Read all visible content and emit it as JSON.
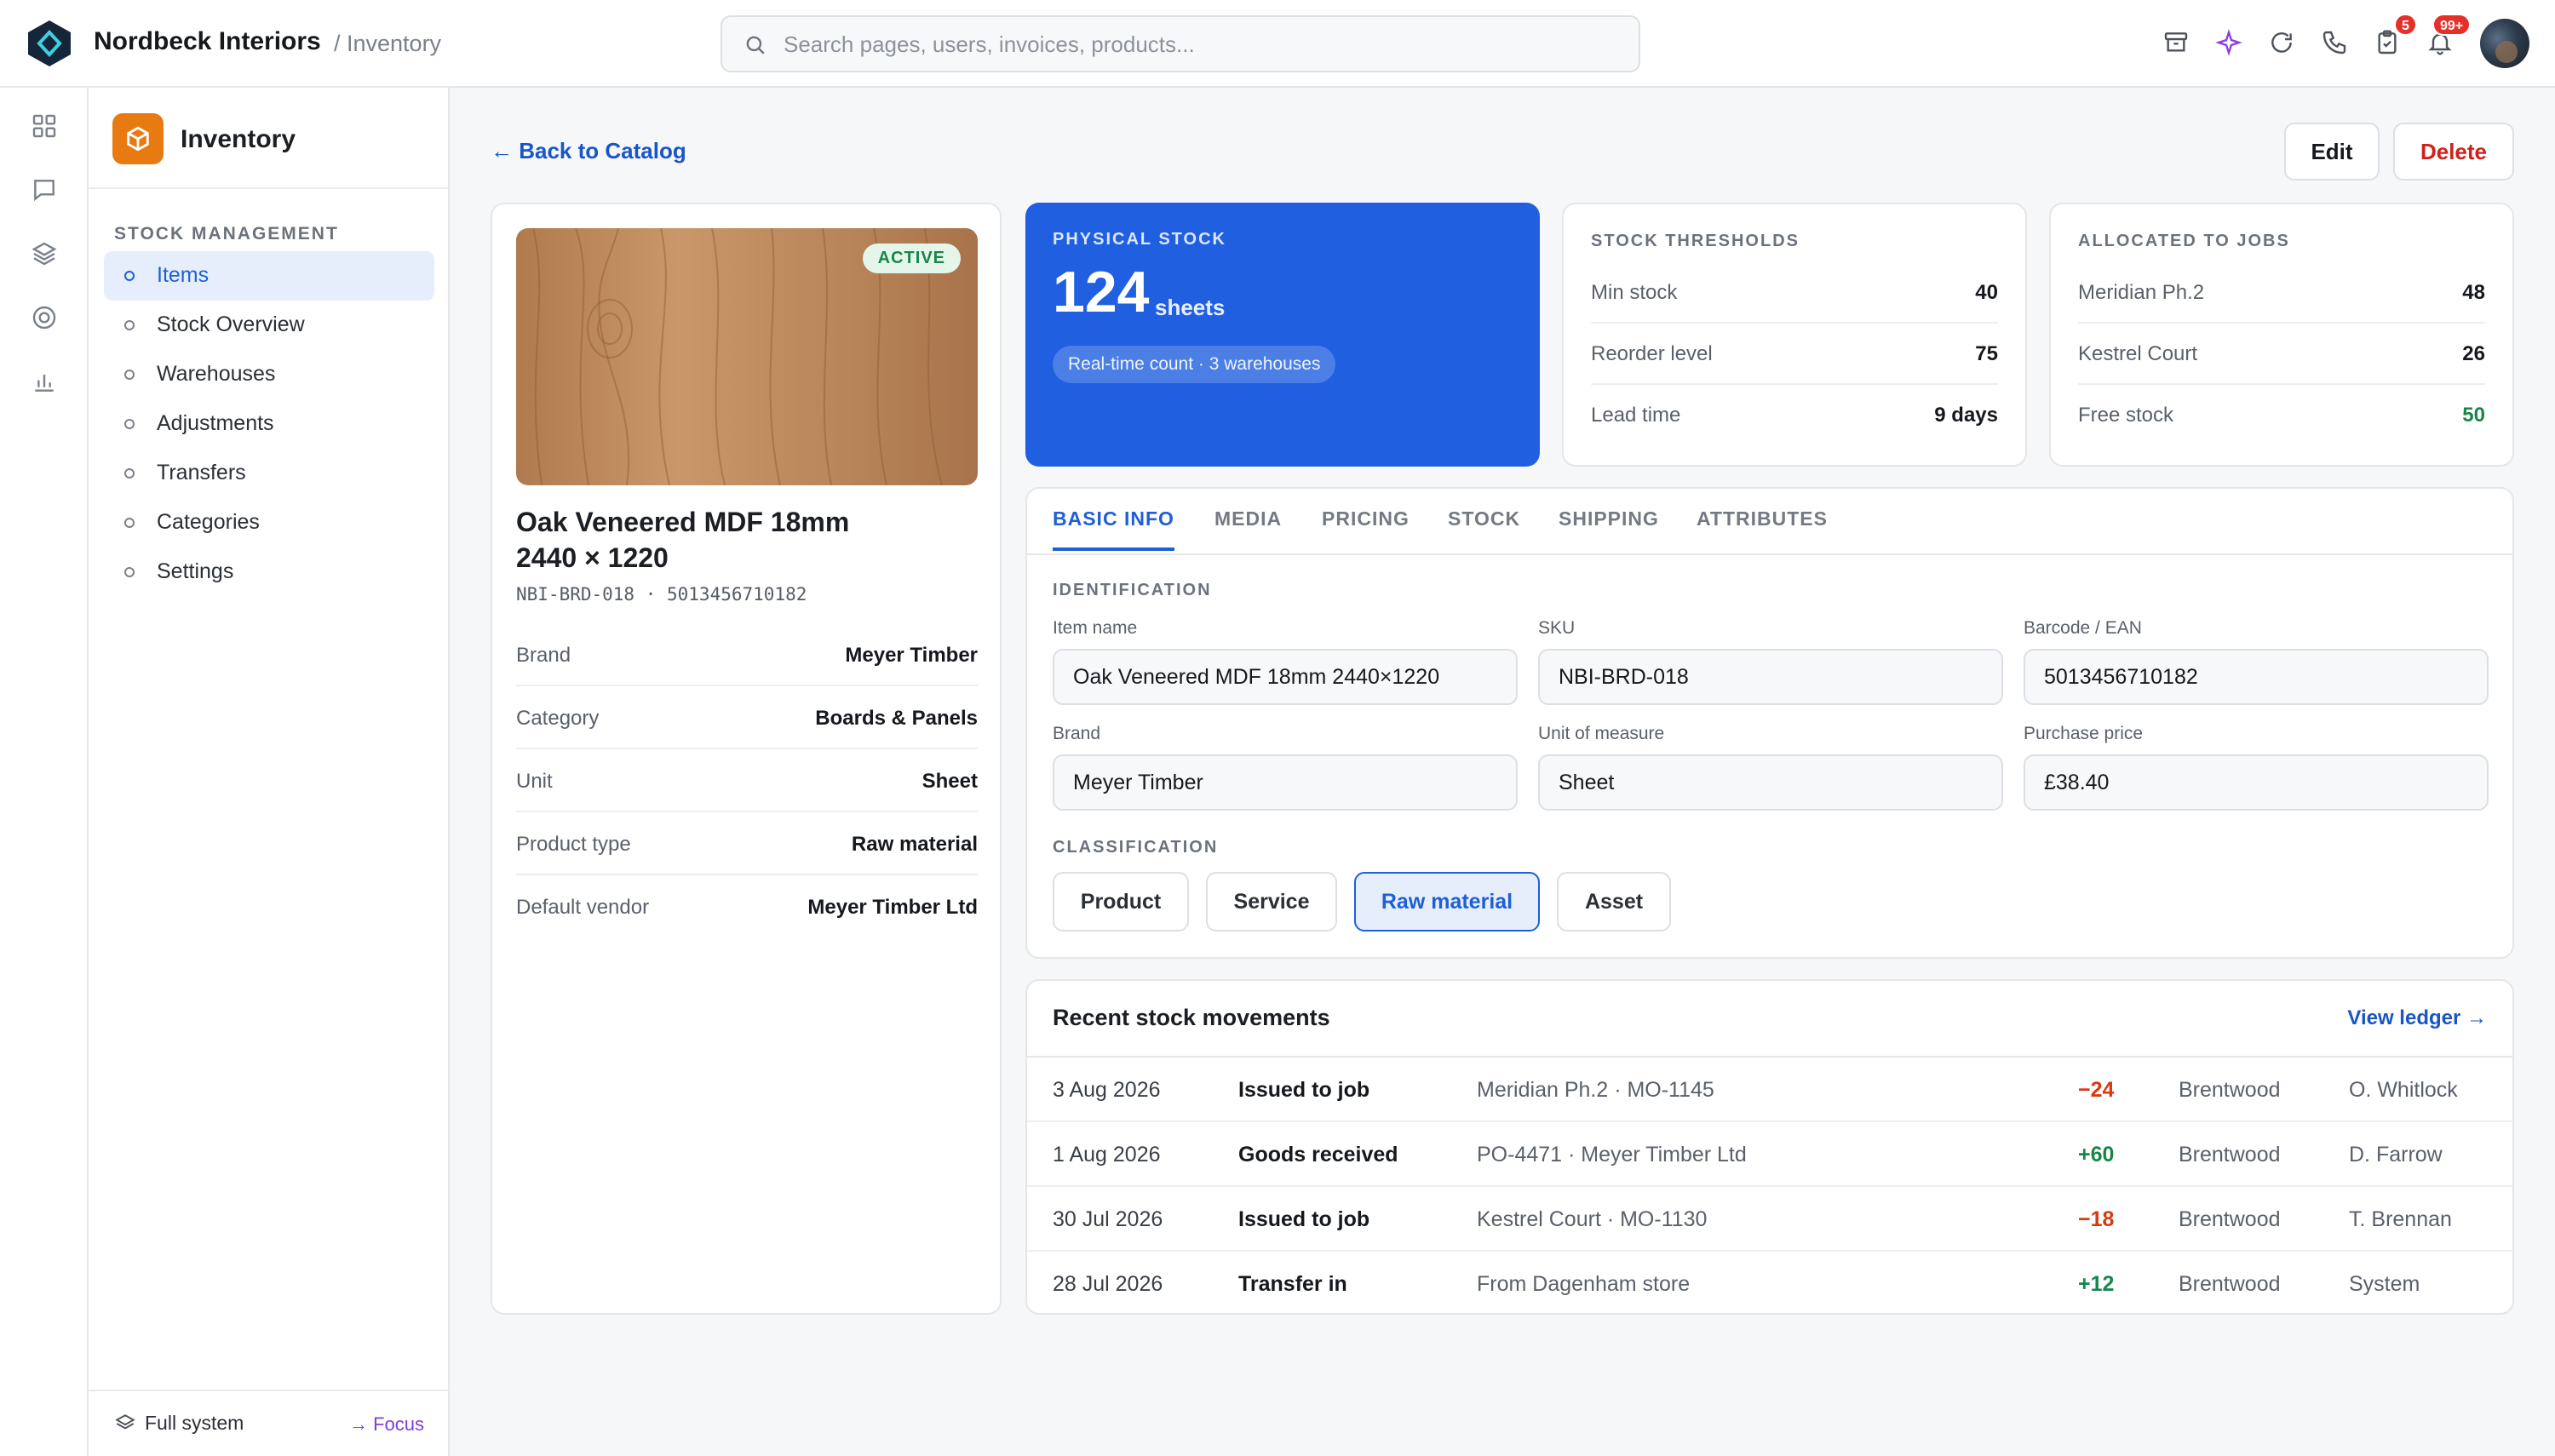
{
  "app": {
    "name": "Nordbeck Interiors",
    "breadcrumb": "/ Inventory"
  },
  "search": {
    "placeholder": "Search pages, users, invoices, products..."
  },
  "header_badges": {
    "tasks": "5",
    "notifications": "99+"
  },
  "sidebar": {
    "title": "Inventory",
    "section": "STOCK MANAGEMENT",
    "items": [
      {
        "label": "Items",
        "active": true
      },
      {
        "label": "Stock Overview"
      },
      {
        "label": "Warehouses"
      },
      {
        "label": "Adjustments"
      },
      {
        "label": "Transfers"
      },
      {
        "label": "Categories"
      },
      {
        "label": "Settings"
      }
    ],
    "footer": {
      "mode": "Full system",
      "focus": "Focus"
    }
  },
  "page": {
    "back": "Back to Catalog",
    "edit": "Edit",
    "delete": "Delete"
  },
  "product": {
    "status": "ACTIVE",
    "title_line1": "Oak Veneered MDF 18mm",
    "title_line2": "2440 × 1220",
    "codes": "NBI-BRD-018  ·  5013456710182",
    "specs": [
      {
        "k": "Brand",
        "v": "Meyer Timber"
      },
      {
        "k": "Category",
        "v": "Boards & Panels"
      },
      {
        "k": "Unit",
        "v": "Sheet"
      },
      {
        "k": "Product type",
        "v": "Raw material"
      },
      {
        "k": "Default vendor",
        "v": "Meyer Timber Ltd"
      }
    ]
  },
  "physical_stock": {
    "label": "PHYSICAL STOCK",
    "value": "124",
    "unit": "sheets",
    "chip": "Real-time count · 3 warehouses"
  },
  "thresholds": {
    "title": "STOCK THRESHOLDS",
    "rows": [
      {
        "k": "Min stock",
        "v": "40"
      },
      {
        "k": "Reorder level",
        "v": "75"
      },
      {
        "k": "Lead time",
        "v": "9 days"
      }
    ]
  },
  "allocated": {
    "title": "ALLOCATED TO JOBS",
    "rows": [
      {
        "k": "Meridian Ph.2",
        "v": "48"
      },
      {
        "k": "Kestrel Court",
        "v": "26"
      },
      {
        "k": "Free stock",
        "v": "50"
      }
    ]
  },
  "tabs": [
    "BASIC INFO",
    "MEDIA",
    "PRICING",
    "STOCK",
    "SHIPPING",
    "ATTRIBUTES"
  ],
  "basic_info": {
    "identification": "IDENTIFICATION",
    "fields": [
      {
        "label": "Item name",
        "value": "Oak Veneered MDF 18mm 2440×1220"
      },
      {
        "label": "SKU",
        "value": "NBI-BRD-018"
      },
      {
        "label": "Barcode / EAN",
        "value": "5013456710182"
      },
      {
        "label": "Brand",
        "value": "Meyer Timber"
      },
      {
        "label": "Unit of measure",
        "value": "Sheet"
      },
      {
        "label": "Purchase price",
        "value": "£38.40"
      }
    ],
    "classification": "CLASSIFICATION",
    "options": [
      "Product",
      "Service",
      "Raw material",
      "Asset"
    ],
    "selected": "Raw material"
  },
  "movements": {
    "title": "Recent stock movements",
    "link": "View ledger →",
    "rows": [
      {
        "date": "3 Aug 2026",
        "type": "Issued to job",
        "ref": "Meridian Ph.2 · MO-1145",
        "qty": "−24",
        "wh": "Brentwood",
        "user": "O. Whitlock"
      },
      {
        "date": "1 Aug 2026",
        "type": "Goods received",
        "ref": "PO-4471 · Meyer Timber Ltd",
        "qty": "+60",
        "wh": "Brentwood",
        "user": "D. Farrow"
      },
      {
        "date": "30 Jul 2026",
        "type": "Issued to job",
        "ref": "Kestrel Court · MO-1130",
        "qty": "−18",
        "wh": "Brentwood",
        "user": "T. Brennan"
      },
      {
        "date": "28 Jul 2026",
        "type": "Transfer in",
        "ref": "From Dagenham store",
        "qty": "+12",
        "wh": "Brentwood",
        "user": "System"
      }
    ]
  },
  "colors": {
    "accent": "#1f5fe0",
    "brand_icon": "#e77b12",
    "positive": "#17864a",
    "negative": "#d63a10"
  }
}
